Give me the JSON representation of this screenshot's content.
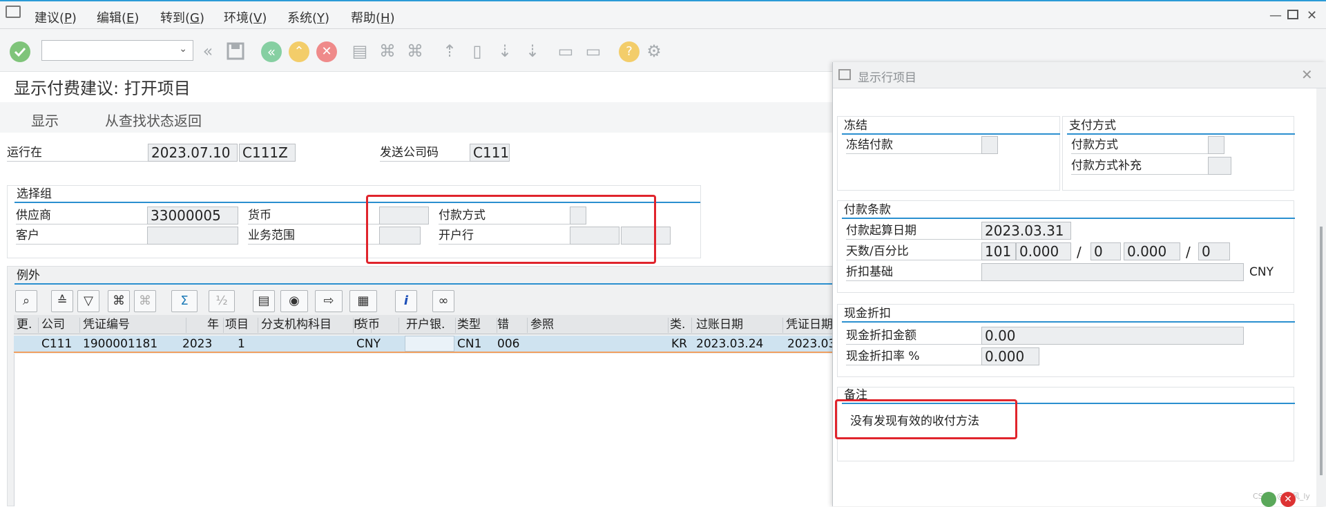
{
  "menu": {
    "items": [
      {
        "text": "建议(",
        "key": "P",
        "end": ")"
      },
      {
        "text": "编辑(",
        "key": "E",
        "end": ")"
      },
      {
        "text": "转到(",
        "key": "G",
        "end": ")"
      },
      {
        "text": "环境(",
        "key": "V",
        "end": ")"
      },
      {
        "text": "系统(",
        "key": "Y",
        "end": ")"
      },
      {
        "text": "帮助(",
        "key": "H",
        "end": ")"
      }
    ]
  },
  "toolbar": {
    "command_value": ""
  },
  "page": {
    "title": "显示付费建议: 打开项目"
  },
  "functions": {
    "display": "显示",
    "back_from_search": "从查找状态返回"
  },
  "header": {
    "run_on_label": "运行在",
    "run_date": "2023.07.10",
    "run_id": "C111Z",
    "paying_company_label": "发送公司码",
    "paying_company": "C111"
  },
  "selection": {
    "group_title": "选择组",
    "vendor_label": "供应商",
    "vendor": "33000005",
    "customer_label": "客户",
    "customer": "",
    "currency_label": "货币",
    "currency": "",
    "business_area_label": "业务范围",
    "business_area": "",
    "payment_method_label": "付款方式",
    "payment_method": "",
    "house_bank_label": "开户行",
    "house_bank_1": "",
    "house_bank_2": ""
  },
  "exceptions": {
    "title": "例外",
    "columns": [
      "更.",
      "公司",
      "凭证编号",
      "年",
      "项目",
      "分支机构科目",
      "P.",
      "货币",
      "开户银.",
      "类型",
      "错",
      "参照",
      "类.",
      "过账日期",
      "凭证日期"
    ],
    "rows": [
      {
        "cells": [
          "",
          "C111",
          "1900001181",
          "2023",
          "1",
          "",
          "",
          "CNY",
          "",
          "CN1",
          "006",
          "",
          "KR",
          "2023.03.24",
          "2023.03"
        ]
      }
    ]
  },
  "dialog": {
    "title": "显示行项目",
    "block": {
      "title": "冻结",
      "block_payment_label": "冻结付款",
      "block_payment": ""
    },
    "paymethod": {
      "title": "支付方式",
      "method_label": "付款方式",
      "method": "",
      "supplement_label": "付款方式补充",
      "supplement": ""
    },
    "terms": {
      "title": "付款条款",
      "baseline_label": "付款起算日期",
      "baseline": "2023.03.31",
      "days_label": "天数/百分比",
      "days1": "101",
      "pct1": "0.000",
      "sep1": "/",
      "days2": "0",
      "pct2": "0.000",
      "sep2": "/",
      "days3": "0",
      "discount_base_label": "折扣基础",
      "discount_base": "",
      "currency": "CNY"
    },
    "cash_discount": {
      "title": "现金折扣",
      "amount_label": "现金折扣金额",
      "amount": "0.00",
      "rate_label": "现金折扣率 %",
      "rate": "0.000"
    },
    "note": {
      "title": "备注",
      "text": "没有发现有效的收付方法"
    },
    "watermark": "CSDN @琉风_ly"
  },
  "colors": {
    "accent": "#2a8fcf",
    "highlight": "#e0242c",
    "row_selected": "#cfe3f0"
  }
}
